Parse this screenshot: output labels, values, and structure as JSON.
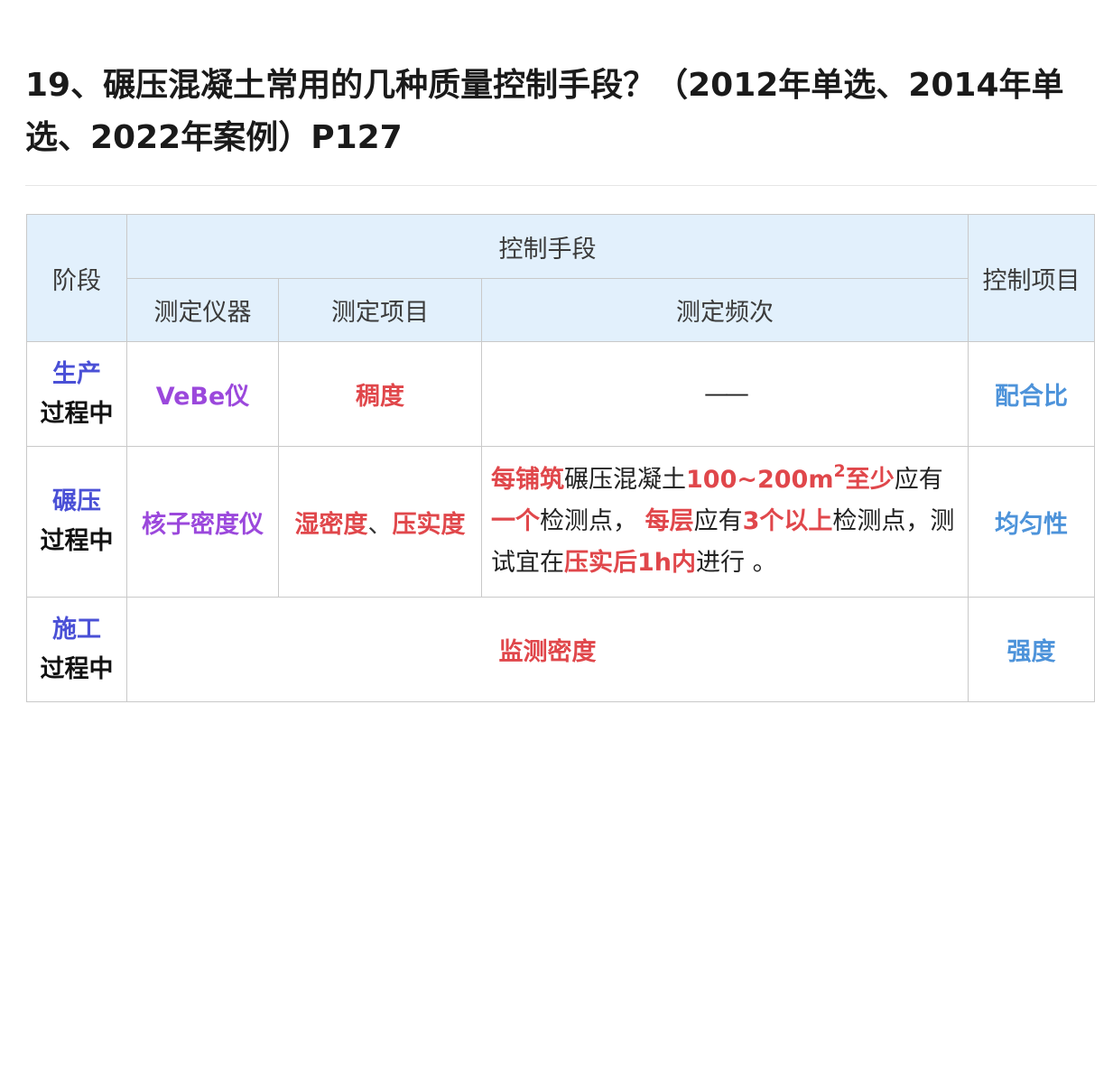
{
  "heading": "19、碾压混凝土常用的几种质量控制手段？（2012年单选、2014年单选、2022年案例）P127",
  "table": {
    "headers": {
      "stage": "阶段",
      "means": "控制手段",
      "instrument": "测定仪器",
      "item": "测定项目",
      "frequency": "测定频次",
      "control_item": "控制项目"
    },
    "rows": [
      {
        "stage_a": "生产",
        "stage_b": "过程中",
        "instrument": "VeBe仪",
        "item": "稠度",
        "frequency": "——",
        "control_item": "配合比"
      },
      {
        "stage_a": "碾压",
        "stage_b": "过程中",
        "instrument": "核子密度仪",
        "item_a": "湿密度",
        "item_sep": "、",
        "item_b": "压实度",
        "freq": {
          "p1": "每铺筑",
          "p2": "碾压混凝土",
          "p3": "100~200m",
          "p3_sup": "2",
          "p4": "至少",
          "p5": "应有",
          "p6": "一个",
          "p7": "检测点，",
          "p8": "每层",
          "p9": "应有",
          "p10": "3个以上",
          "p11": "检测点，",
          "p12": "测试宜在",
          "p13": "压实后1h内",
          "p14": "进行 。"
        },
        "control_item": "均匀性"
      },
      {
        "stage_a": "施工",
        "stage_b": "过程中",
        "merged": "监测密度",
        "control_item": "强度"
      }
    ]
  },
  "colors": {
    "header_bg": "#e2f0fc",
    "stage_accent": "#4a50d6",
    "instrument": "#9b48dc",
    "emphasis_red": "#e0474b",
    "control_blue": "#4d93da"
  }
}
